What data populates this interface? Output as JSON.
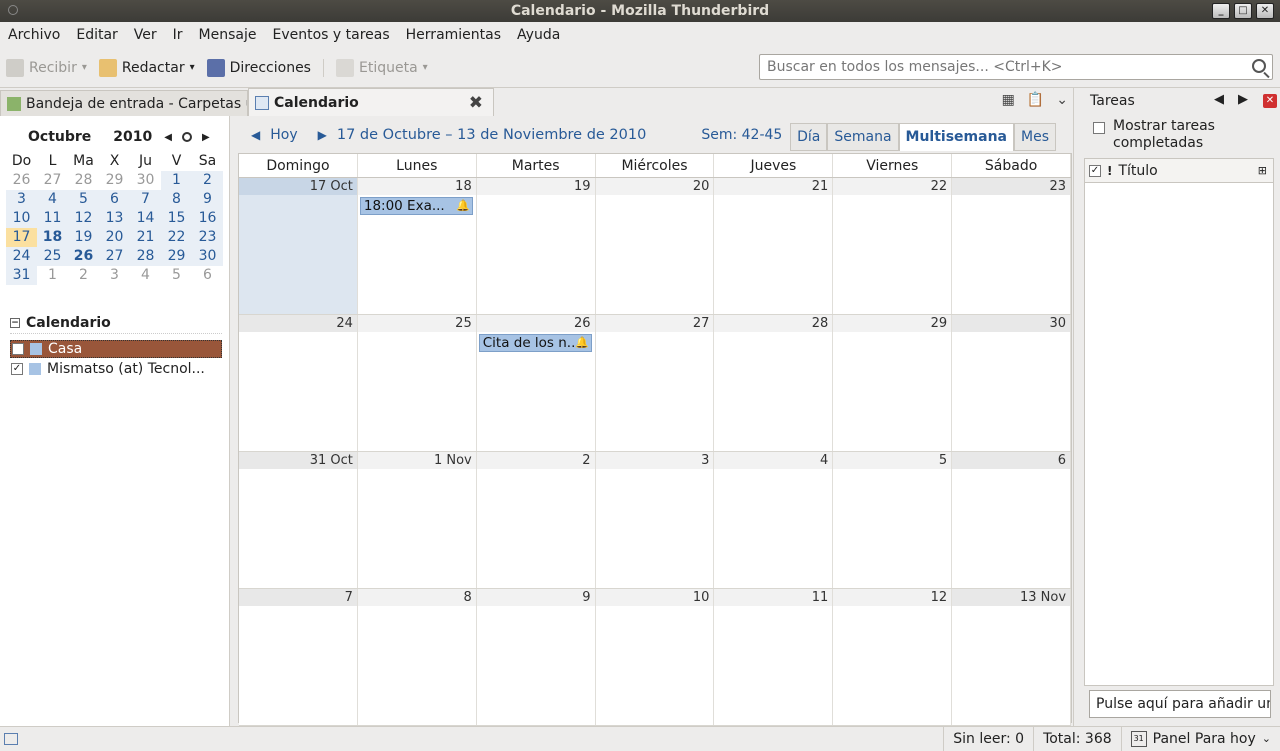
{
  "window": {
    "title": "Calendario - Mozilla Thunderbird"
  },
  "menu": [
    "Archivo",
    "Editar",
    "Ver",
    "Ir",
    "Mensaje",
    "Eventos y tareas",
    "Herramientas",
    "Ayuda"
  ],
  "toolbar": {
    "get_mail": "Recibir",
    "compose": "Redactar",
    "address_book": "Direcciones",
    "tag": "Etiqueta",
    "search_placeholder": "Buscar en todos los mensajes... <Ctrl+K>"
  },
  "tabs": [
    {
      "label": "Bandeja de entrada - Carpetas u..."
    },
    {
      "label": "Calendario"
    }
  ],
  "minimonth": {
    "month": "Octubre",
    "year": "2010",
    "weekdays": [
      "Do",
      "L",
      "Ma",
      "X",
      "Ju",
      "V",
      "Sa"
    ],
    "weeks": [
      [
        "26",
        "27",
        "28",
        "29",
        "30",
        "1",
        "2"
      ],
      [
        "3",
        "4",
        "5",
        "6",
        "7",
        "8",
        "9"
      ],
      [
        "10",
        "11",
        "12",
        "13",
        "14",
        "15",
        "16"
      ],
      [
        "17",
        "18",
        "19",
        "20",
        "21",
        "22",
        "23"
      ],
      [
        "24",
        "25",
        "26",
        "27",
        "28",
        "29",
        "30"
      ],
      [
        "31",
        "1",
        "2",
        "3",
        "4",
        "5",
        "6"
      ]
    ]
  },
  "calendars": {
    "heading": "Calendario",
    "items": [
      {
        "name": "Casa",
        "checked": false
      },
      {
        "name": "Mismatso (at) Tecnol...",
        "checked": true
      }
    ]
  },
  "nav": {
    "today": "Hoy",
    "range": "17 de Octubre – 13 de Noviembre de 2010",
    "weeks": "Sem: 42-45"
  },
  "views": [
    "Día",
    "Semana",
    "Multisemana",
    "Mes"
  ],
  "grid": {
    "days": [
      "Domingo",
      "Lunes",
      "Martes",
      "Miércoles",
      "Jueves",
      "Viernes",
      "Sábado"
    ],
    "weeks": [
      [
        "17 Oct",
        "18",
        "19",
        "20",
        "21",
        "22",
        "23"
      ],
      [
        "24",
        "25",
        "26",
        "27",
        "28",
        "29",
        "30"
      ],
      [
        "31 Oct",
        "1 Nov",
        "2",
        "3",
        "4",
        "5",
        "6"
      ],
      [
        "7",
        "8",
        "9",
        "10",
        "11",
        "12",
        "13 Nov"
      ]
    ],
    "events": [
      {
        "week": 0,
        "day": 1,
        "label": "18:00 Exa..."
      },
      {
        "week": 1,
        "day": 2,
        "label": "Cita de los n..."
      }
    ]
  },
  "tasks": {
    "title": "Tareas",
    "show_completed": "Mostrar tareas completadas",
    "column_title": "Título",
    "add_placeholder": "Pulse aquí para añadir una"
  },
  "status": {
    "unread": "Sin leer: 0",
    "total": "Total: 368",
    "panel": "Panel Para hoy"
  }
}
